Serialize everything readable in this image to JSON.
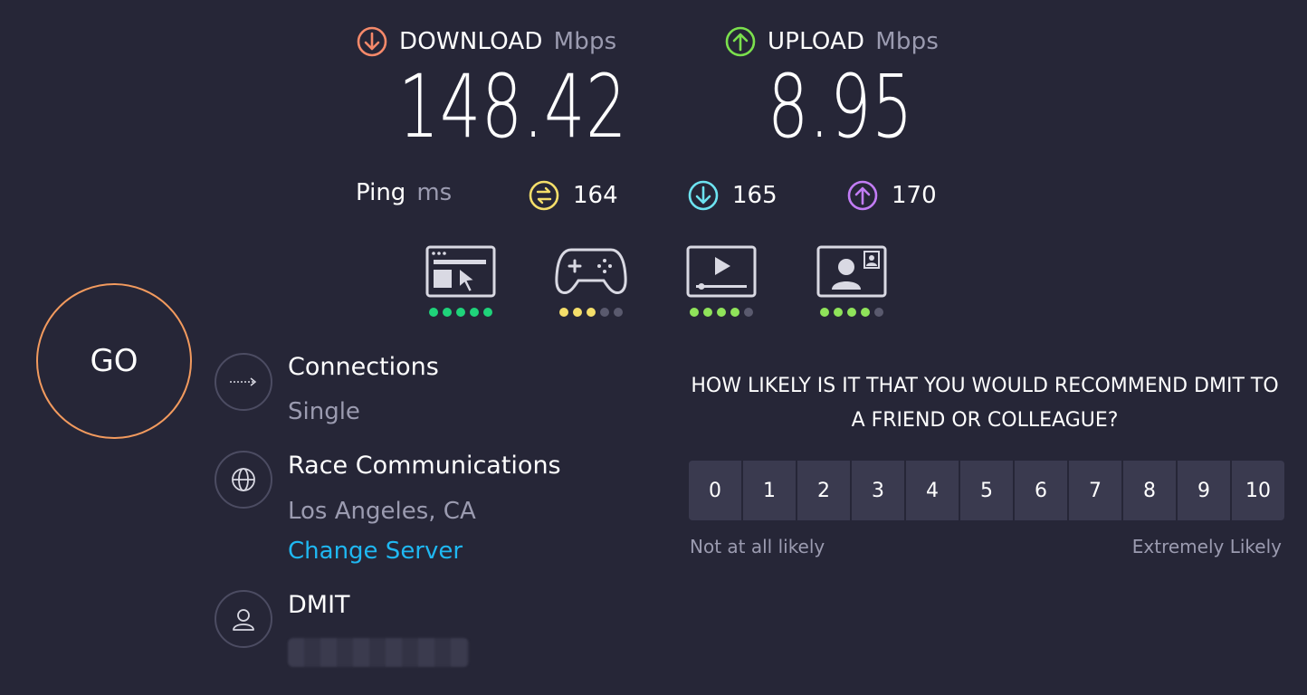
{
  "download": {
    "label": "DOWNLOAD",
    "unit": "Mbps",
    "value": "148.42",
    "color": "#f5896a"
  },
  "upload": {
    "label": "UPLOAD",
    "unit": "Mbps",
    "value": "8.95",
    "color": "#7be04d"
  },
  "ping": {
    "label": "Ping",
    "unit": "ms",
    "idle": {
      "value": "164",
      "color": "#f4de6a"
    },
    "download": {
      "value": "165",
      "color": "#6de3f0"
    },
    "upload": {
      "value": "170",
      "color": "#c27cf5"
    }
  },
  "quality": [
    {
      "icon": "web-browsing-icon",
      "rating": 5,
      "color": "#1fd37a"
    },
    {
      "icon": "gaming-icon",
      "rating": 3,
      "color": "#f4de6a"
    },
    {
      "icon": "video-streaming-icon",
      "rating": 4,
      "color": "#8fe35a"
    },
    {
      "icon": "video-chat-icon",
      "rating": 4,
      "color": "#8fe35a"
    }
  ],
  "go_label": "GO",
  "connections": {
    "title": "Connections",
    "value": "Single"
  },
  "server": {
    "title": "Race Communications",
    "location": "Los Angeles, CA",
    "change_label": "Change Server"
  },
  "provider": {
    "title": "DMIT"
  },
  "survey": {
    "question": "HOW LIKELY IS IT THAT YOU WOULD RECOMMEND DMIT TO A FRIEND OR COLLEAGUE?",
    "options": [
      "0",
      "1",
      "2",
      "3",
      "4",
      "5",
      "6",
      "7",
      "8",
      "9",
      "10"
    ],
    "low_label": "Not at all likely",
    "high_label": "Extremely Likely"
  }
}
